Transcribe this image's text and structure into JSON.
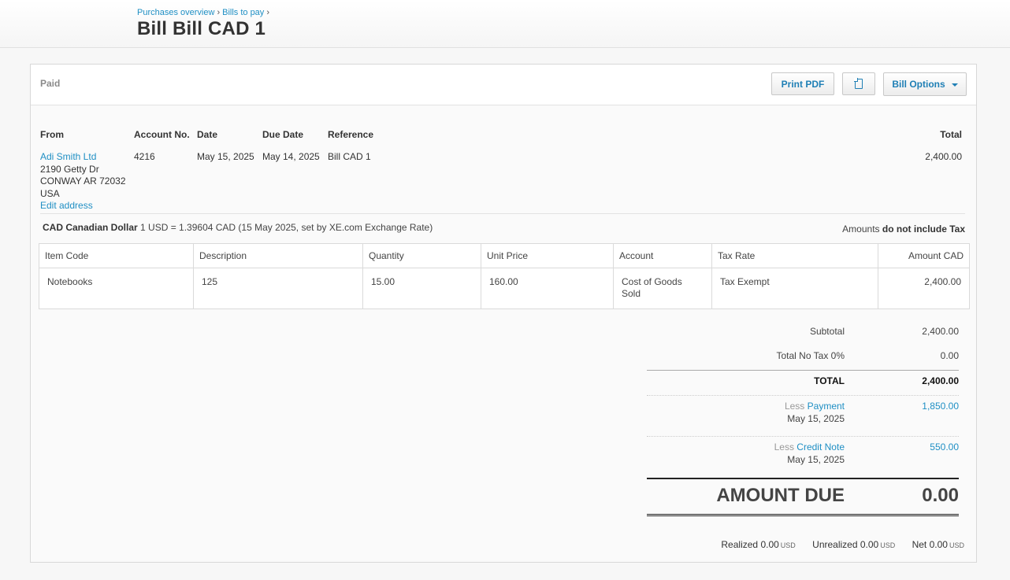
{
  "breadcrumb": {
    "item1": "Purchases overview",
    "item2": "Bills to pay",
    "sep": "›"
  },
  "page_title": "Bill Bill CAD 1",
  "status": "Paid",
  "buttons": {
    "print": "Print PDF",
    "copy_icon": "copy-icon",
    "options": "Bill Options"
  },
  "info": {
    "from_label": "From",
    "from_name": "Adi Smith Ltd",
    "address_line1": "2190 Getty Dr",
    "address_line2": "CONWAY AR 72032",
    "address_line3": "USA",
    "edit_address": "Edit address",
    "account_label": "Account No.",
    "account_value": "4216",
    "date_label": "Date",
    "date_value": "May 15, 2025",
    "due_label": "Due Date",
    "due_value": "May 14, 2025",
    "reference_label": "Reference",
    "reference_value": "Bill CAD 1",
    "total_label": "Total",
    "total_value": "2,400.00"
  },
  "currency": {
    "code": "CAD Canadian Dollar",
    "rate": "1 USD = 1.39604 CAD (15 May 2025, set by XE.com Exchange Rate)",
    "amounts_prefix": "Amounts",
    "amounts_tax": "do not include Tax"
  },
  "table": {
    "headers": [
      "Item Code",
      "Description",
      "Quantity",
      "Unit Price",
      "Account",
      "Tax Rate",
      "Amount CAD"
    ],
    "rows": [
      [
        "Notebooks",
        "125",
        "15.00",
        "160.00",
        "Cost of Goods Sold",
        "Tax Exempt",
        "2,400.00"
      ]
    ]
  },
  "totals": {
    "subtotal_label": "Subtotal",
    "subtotal_value": "2,400.00",
    "notax_label": "Total No Tax 0%",
    "notax_value": "0.00",
    "total_label": "TOTAL",
    "total_value": "2,400.00",
    "payment_less": "Less",
    "payment_link": "Payment",
    "payment_date": "May 15, 2025",
    "payment_value": "1,850.00",
    "credit_less": "Less",
    "credit_link": "Credit Note",
    "credit_date": "May 15, 2025",
    "credit_value": "550.00",
    "amount_due_label": "AMOUNT DUE",
    "amount_due_value": "0.00"
  },
  "realized": {
    "realized_label": "Realized",
    "realized_value": "0.00",
    "realized_unit": "USD",
    "unrealized_label": "Unrealized",
    "unrealized_value": "0.00",
    "unrealized_unit": "USD",
    "net_label": "Net",
    "net_value": "0.00",
    "net_unit": "USD"
  }
}
